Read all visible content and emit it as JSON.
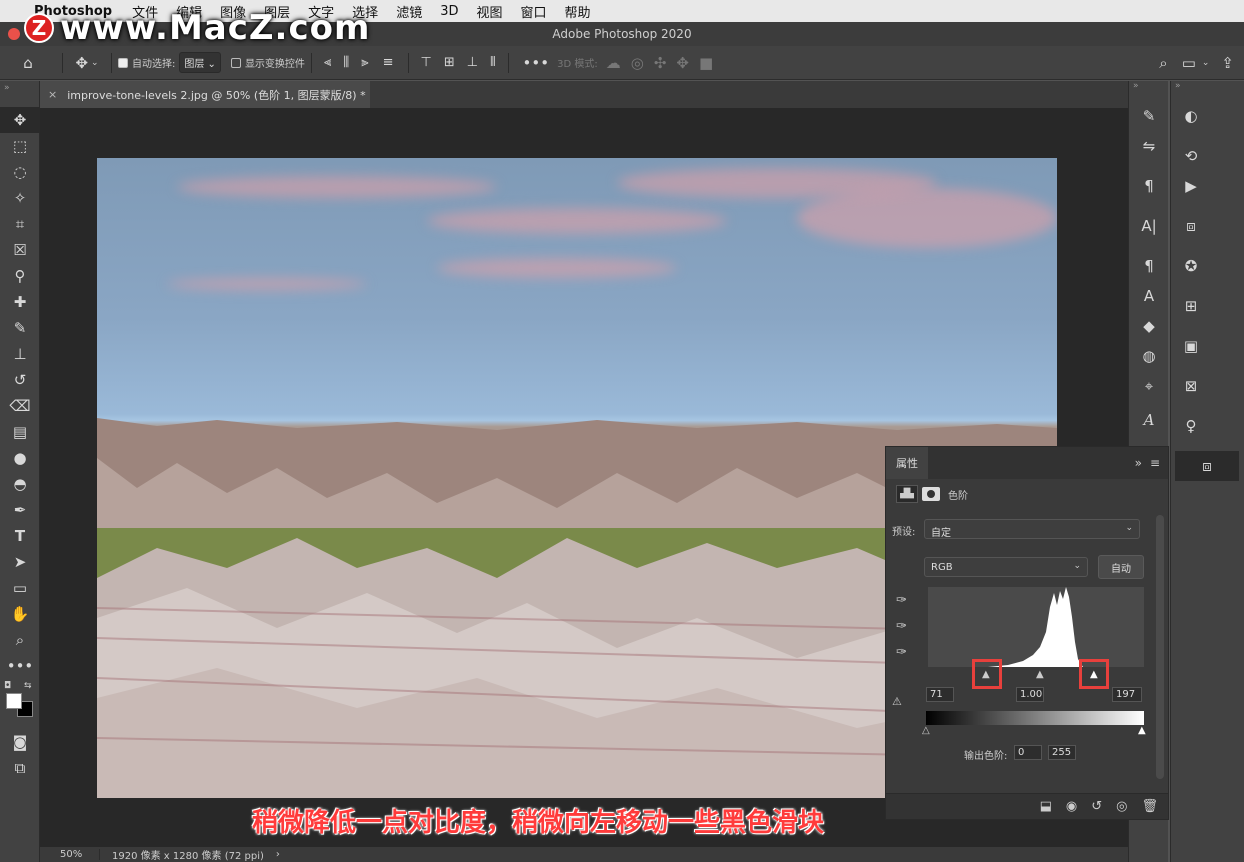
{
  "menubar": {
    "app_name": "Photoshop",
    "items": [
      "文件",
      "编辑",
      "图像",
      "图层",
      "文字",
      "选择",
      "滤镜",
      "3D",
      "视图",
      "窗口",
      "帮助"
    ]
  },
  "window": {
    "title": "Adobe Photoshop 2020"
  },
  "watermark": {
    "text": "www.MacZ.com",
    "logo_letter": "Z"
  },
  "options_bar": {
    "auto_select_label": "自动选择:",
    "auto_select_value": "图层",
    "show_transform_label": "显示变换控件",
    "mode_3d_label": "3D 模式:"
  },
  "document_tab": {
    "title": "improve-tone-levels 2.jpg @ 50% (色阶 1, 图层蒙版/8) *"
  },
  "status_bar": {
    "zoom": "50%",
    "info": "1920 像素 x 1280 像素 (72 ppi)"
  },
  "properties": {
    "tab_label": "属性",
    "adjustment_label": "色阶",
    "preset_label": "预设:",
    "preset_value": "自定",
    "channel_value": "RGB",
    "auto_button": "自动",
    "input_black": "71",
    "input_gamma": "1.00",
    "input_white": "197",
    "output_label": "输出色阶:",
    "output_black": "0",
    "output_white": "255"
  },
  "histogram": {
    "black_point": 71,
    "gamma": 1.0,
    "white_point": 197
  },
  "caption": {
    "text": "稍微降低一点对比度，稍微向左移动一些黑色滑块"
  },
  "colors": {
    "accent_red": "#e8403c",
    "caption_red": "#ff3b3b"
  }
}
